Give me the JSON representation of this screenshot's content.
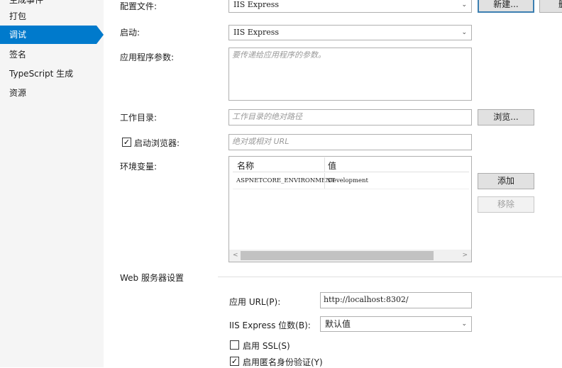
{
  "sidebar": {
    "items": [
      {
        "label": "生成事件"
      },
      {
        "label": "打包"
      },
      {
        "label": "调试"
      },
      {
        "label": "签名"
      },
      {
        "label": "TypeScript 生成"
      },
      {
        "label": "资源"
      }
    ]
  },
  "profile": {
    "label": "配置文件:",
    "value": "IIS Express",
    "new_button": "新建...",
    "delete_button": "删"
  },
  "launch": {
    "label": "启动:",
    "value": "IIS Express"
  },
  "app_args": {
    "label": "应用程序参数:",
    "placeholder": "要传递给应用程序的参数。"
  },
  "working_dir": {
    "label": "工作目录:",
    "placeholder": "工作目录的绝对路径",
    "browse_button": "浏览..."
  },
  "launch_browser": {
    "label": "启动浏览器:",
    "checked": "✓",
    "placeholder": "绝对或相对 URL"
  },
  "env_vars": {
    "label": "环境变量:",
    "columns": [
      "名称",
      "值"
    ],
    "rows": [
      {
        "name": "ASPNETCORE_ENVIRONMENT",
        "value": "Development"
      }
    ],
    "add_button": "添加",
    "remove_button": "移除",
    "scroll_left": "<",
    "scroll_right": ">"
  },
  "web_server": {
    "section_title": "Web 服务器设置",
    "app_url_label": "应用 URL(P):",
    "app_url_value": "http://localhost:8302/",
    "bitness_label": "IIS Express 位数(B):",
    "bitness_value": "默认值",
    "ssl_label": "启用 SSL(S)",
    "anon_auth_label": "启用匿名身份验证(Y)",
    "anon_checked": "✓"
  }
}
